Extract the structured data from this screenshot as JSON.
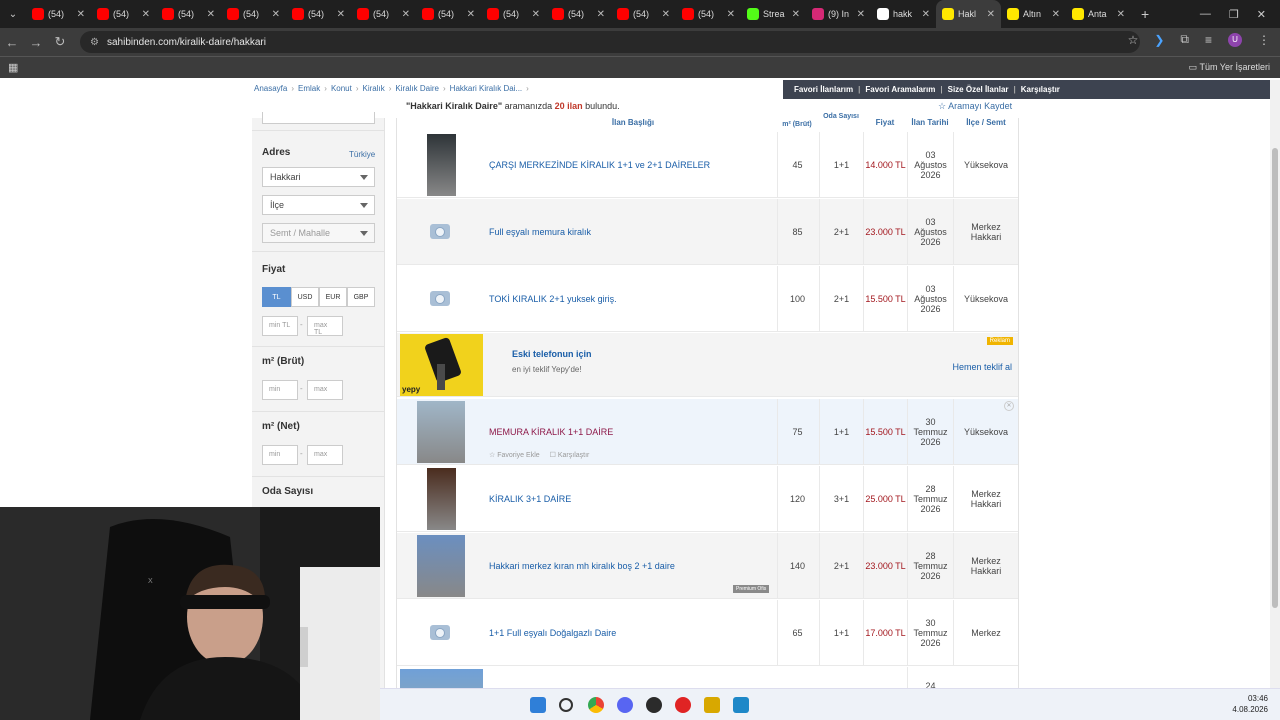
{
  "browser": {
    "tabs": [
      {
        "label": "(54)",
        "icon": "youtube-icon",
        "color": "#ff0000"
      },
      {
        "label": "(54)",
        "icon": "youtube-icon",
        "color": "#ff0000"
      },
      {
        "label": "(54)",
        "icon": "youtube-icon",
        "color": "#ff0000"
      },
      {
        "label": "(54)",
        "icon": "youtube-icon",
        "color": "#ff0000"
      },
      {
        "label": "(54)",
        "icon": "youtube-icon",
        "color": "#ff0000"
      },
      {
        "label": "(54)",
        "icon": "youtube-icon",
        "color": "#ff0000"
      },
      {
        "label": "(54)",
        "icon": "youtube-icon",
        "color": "#ff0000"
      },
      {
        "label": "(54)",
        "icon": "youtube-icon",
        "color": "#ff0000"
      },
      {
        "label": "(54)",
        "icon": "youtube-icon",
        "color": "#ff0000"
      },
      {
        "label": "(54)",
        "icon": "youtube-icon",
        "color": "#ff0000"
      },
      {
        "label": "(54)",
        "icon": "youtube-icon",
        "color": "#ff0000"
      },
      {
        "label": "Strea",
        "icon": "kick-icon",
        "color": "#53fc18"
      },
      {
        "label": "(9) In",
        "icon": "instagram-icon",
        "color": "#d62976"
      },
      {
        "label": "hakk",
        "icon": "google-icon",
        "color": "#ffffff"
      },
      {
        "label": "Hakl",
        "icon": "sahibinden-icon",
        "color": "#ffe800"
      },
      {
        "label": "Altın",
        "icon": "sahibinden-icon",
        "color": "#ffe800"
      },
      {
        "label": "Anta",
        "icon": "sahibinden-icon",
        "color": "#ffe800"
      }
    ],
    "url": "sahibinden.com/kiralik-daire/hakkari",
    "bookmarks_all": "Tüm Yer İşaretleri"
  },
  "header": {
    "breadcrumbs": [
      "Anasayfa",
      "Emlak",
      "Konut",
      "Kiralık",
      "Kiralık Daire",
      "Hakkari Kiralık Dai..."
    ],
    "top_links": [
      "Favori İlanlarım",
      "Favori Aramalarım",
      "Size Özel İlanlar",
      "Karşılaştır"
    ],
    "result_query": "\"Hakkari Kiralık Daire\"",
    "result_mid": " aramanızda ",
    "result_count": "20 ilan",
    "result_end": " bulundu.",
    "save_search": "Aramayı Kaydet"
  },
  "sidebar": {
    "address_title": "Adres",
    "country": "Türkiye",
    "city": "Hakkari",
    "district": "İlçe",
    "neighborhood": "Semt / Mahalle",
    "price_title": "Fiyat",
    "currencies": [
      "TL",
      "USD",
      "EUR",
      "GBP"
    ],
    "min_tl": "min TL",
    "max_tl": "max TL",
    "gross_title": "m² (Brüt)",
    "net_title": "m² (Net)",
    "min": "min",
    "max": "max",
    "rooms_title": "Oda Sayısı"
  },
  "table": {
    "headers": {
      "title": "İlan Başlığı",
      "m2": "m² (Brüt)",
      "rooms": "Oda Sayısı",
      "price": "Fiyat",
      "date": "İlan Tarihi",
      "location": "İlçe / Semt"
    },
    "rows": [
      {
        "title": "ÇARŞI MERKEZİNDE KİRALIK 1+1 ve 2+1 DAİRELER",
        "m2": "45",
        "rooms": "1+1",
        "price": "14.000 TL",
        "date": "03 Ağustos 2026",
        "location": "Yüksekova"
      },
      {
        "title": "Full eşyalı memura kiralık",
        "m2": "85",
        "rooms": "2+1",
        "price": "23.000 TL",
        "date": "03 Ağustos 2026",
        "location": "Merkez Hakkari"
      },
      {
        "title": "TOKİ KIRALIK 2+1 yuksek giriş.",
        "m2": "100",
        "rooms": "2+1",
        "price": "15.500 TL",
        "date": "03 Ağustos 2026",
        "location": "Yüksekova"
      },
      {
        "title": "MEMURA KİRALIK 1+1 DAİRE",
        "m2": "75",
        "rooms": "1+1",
        "price": "15.500 TL",
        "date": "30 Temmuz 2026",
        "location": "Yüksekova",
        "fav": "Favoriye Ekle",
        "compare": "Karşılaştır"
      },
      {
        "title": "KİRALIK 3+1 DAİRE",
        "m2": "120",
        "rooms": "3+1",
        "price": "25.000 TL",
        "date": "28 Temmuz 2026",
        "location": "Merkez Hakkari"
      },
      {
        "title": "Hakkari merkez kıran mh kiralık boş 2 +1 daire",
        "m2": "140",
        "rooms": "2+1",
        "price": "23.000 TL",
        "date": "28 Temmuz 2026",
        "location": "Merkez Hakkari",
        "badge": "Premium Ofis"
      },
      {
        "title": "1+1 Full eşyalı Doğalgazlı Daire",
        "m2": "65",
        "rooms": "1+1",
        "price": "17.000 TL",
        "date": "30 Temmuz 2026",
        "location": "Merkez"
      }
    ],
    "partial_date": "24"
  },
  "ad": {
    "title": "Eski telefonun için",
    "subtitle": "en iyi teklif Yepy'de!",
    "badge": "Reklam",
    "link": "Hemen teklif al",
    "brand": "yepy"
  },
  "taskbar": {
    "time": "03:46",
    "date": "4.08.2026"
  }
}
